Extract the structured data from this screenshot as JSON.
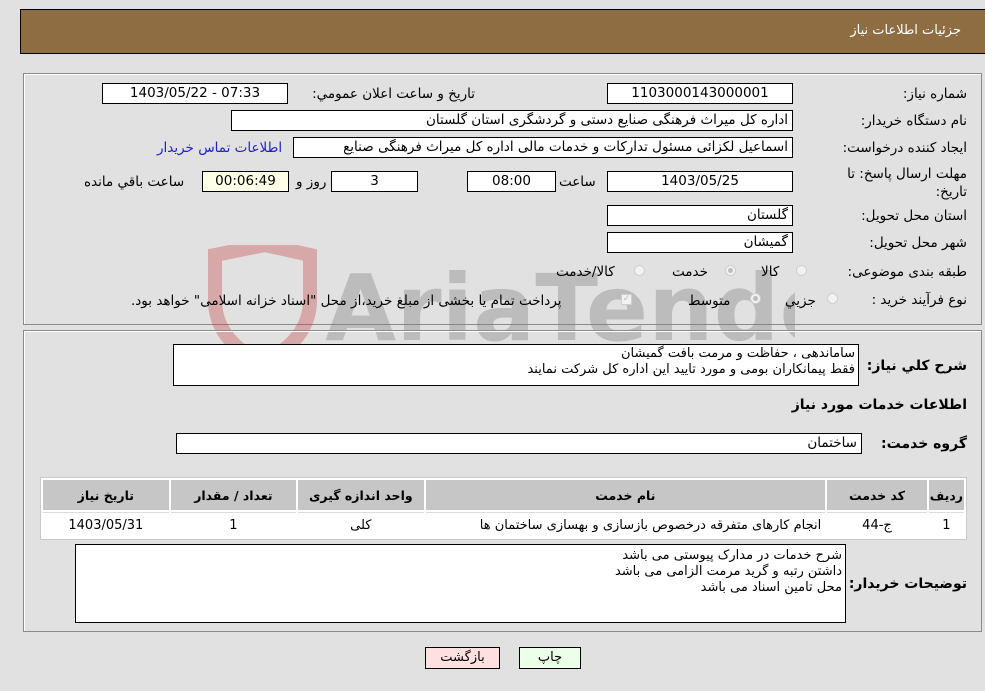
{
  "header": {
    "title": "جزئیات اطلاعات نیاز"
  },
  "fields": {
    "need_number": {
      "label": "شماره نیاز:",
      "value": "1103000143000001"
    },
    "announce_datetime": {
      "label": "تاریخ و ساعت اعلان عمومي:",
      "value": "1403/05/22 - 07:33"
    },
    "buyer_org": {
      "label": "نام دستگاه خريدار:",
      "value": "اداره کل میراث فرهنگی  صنایع دستی و گردشگری استان گلستان"
    },
    "requester": {
      "label": "ایجاد کننده درخواست:",
      "value": "اسماعیل لکزائی مسئول تدارکات و خدمات مالی اداره کل میراث فرهنگی  صنایع",
      "contact_link": "اطلاعات تماس خریدار"
    },
    "deadline": {
      "label": "مهلت ارسال پاسخ: تا تاریخ:",
      "date": "1403/05/25",
      "time_label": "ساعت",
      "time": "08:00",
      "days": "3",
      "days_label": "روز و",
      "remaining": "00:06:49",
      "remaining_label": "ساعت باقي مانده"
    },
    "province": {
      "label": "استان محل تحویل:",
      "value": "گلستان"
    },
    "city": {
      "label": "شهر محل تحویل:",
      "value": "گمیشان"
    },
    "category": {
      "label": "طبقه بندی موضوعی:",
      "options": [
        "کالا",
        "خدمت",
        "کالا/خدمت"
      ],
      "selected": "خدمت"
    },
    "purchase_type": {
      "label": "نوع فرآیند خرید :",
      "options": [
        "جزيي",
        "متوسط"
      ],
      "selected": "متوسط",
      "treasury_note": "پرداخت تمام یا بخشی از مبلغ خرید،از محل \"اسناد خزانه اسلامی\" خواهد بود.",
      "treasury_checked": true
    }
  },
  "summary": {
    "label": "شرح کلي نياز:",
    "value": "ساماندهی ، حفاظت و مرمت بافت گمیشان\nفقط پیمانکاران بومی و مورد تایید این اداره کل شرکت نمایند"
  },
  "services_section": {
    "title": "اطلاعات خدمات مورد نياز",
    "group_label": "گروه خدمت:",
    "group_value": "ساختمان"
  },
  "table": {
    "headers": [
      "ردیف",
      "کد خدمت",
      "نام خدمت",
      "واحد اندازه گیری",
      "تعداد / مقدار",
      "تاریخ نیاز"
    ],
    "rows": [
      [
        "1",
        "ج-44",
        "انجام کارهای متفرقه درخصوص بازسازی و بهسازی ساختمان ها",
        "کلی",
        "1",
        "1403/05/31"
      ]
    ]
  },
  "buyer_notes": {
    "label": "توضیحات خریدار:",
    "value": "شرح خدمات در مدارک پیوستی می باشد\nداشتن رتبه و گرید مرمت الزامی می باشد\nمحل تامین اسناد می باشد"
  },
  "buttons": {
    "print": "چاپ",
    "back": "بازگشت"
  },
  "watermark": {
    "text": "AriaTender.neT",
    "color": "#d9a0a0"
  }
}
